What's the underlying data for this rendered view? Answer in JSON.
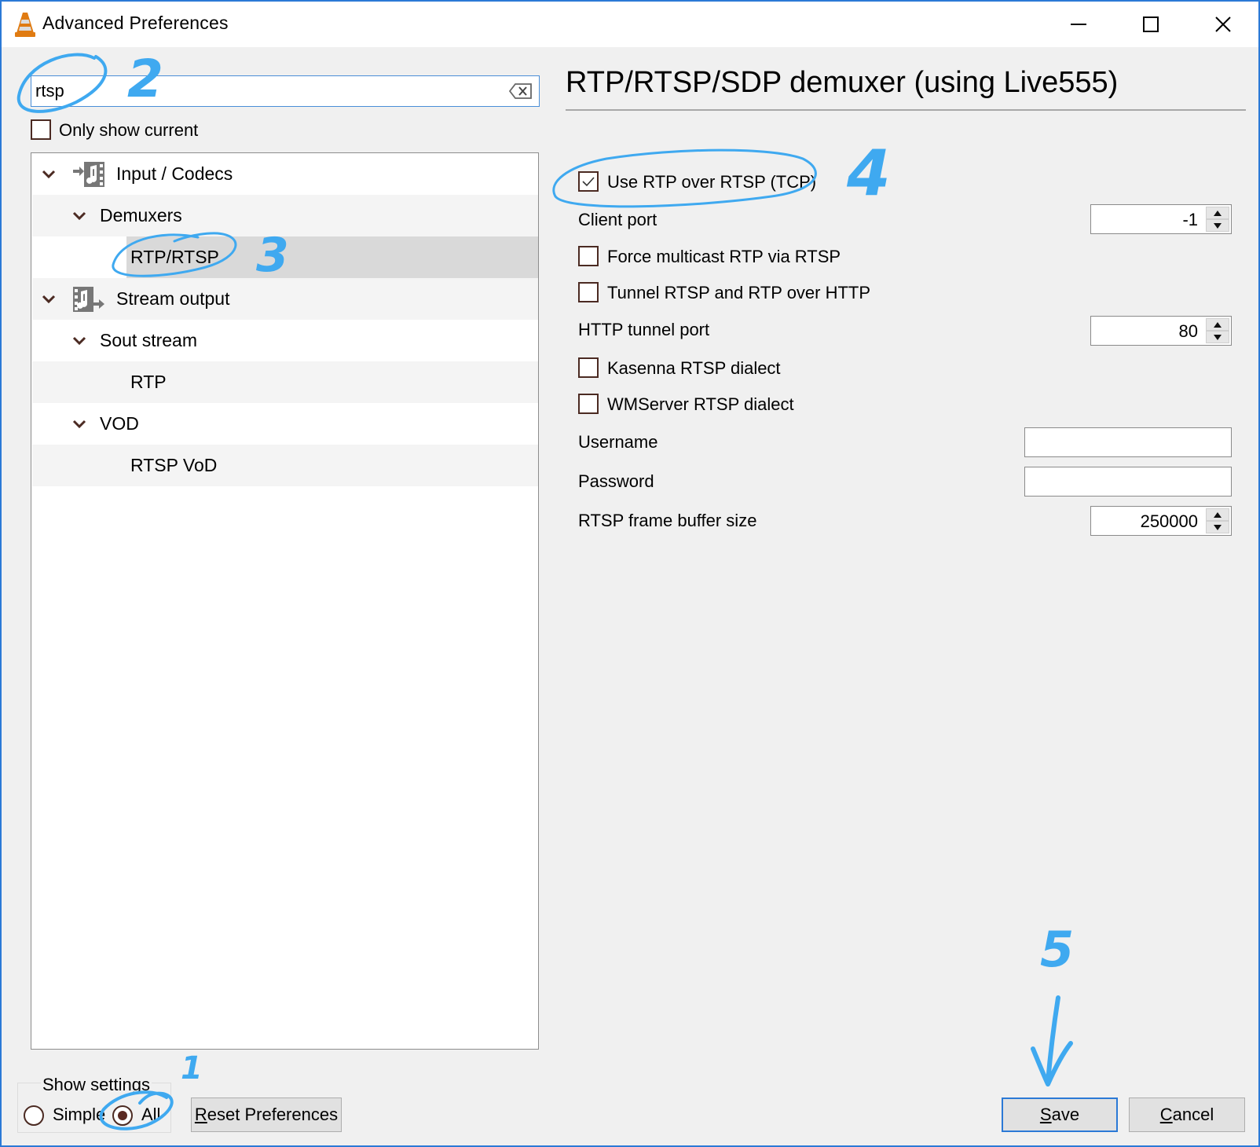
{
  "window": {
    "title": "Advanced Preferences",
    "controls": {
      "minimize": "minimize",
      "maximize": "maximize",
      "close": "close"
    }
  },
  "left": {
    "search": {
      "value": "rtsp",
      "clear_icon": "clear-backspace-icon"
    },
    "only_show_current": {
      "label": "Only show current",
      "checked": false
    },
    "tree": [
      {
        "label": "Input / Codecs",
        "level": 0,
        "expanded": true,
        "icon": "input-codecs-icon",
        "selected": false
      },
      {
        "label": "Demuxers",
        "level": 1,
        "expanded": true,
        "selected": false
      },
      {
        "label": "RTP/RTSP",
        "level": 2,
        "selected": true
      },
      {
        "label": "Stream output",
        "level": 0,
        "expanded": true,
        "icon": "stream-output-icon",
        "selected": false
      },
      {
        "label": "Sout stream",
        "level": 1,
        "expanded": true,
        "selected": false
      },
      {
        "label": "RTP",
        "level": 2,
        "selected": false
      },
      {
        "label": "VOD",
        "level": 1,
        "expanded": true,
        "selected": false
      },
      {
        "label": "RTSP VoD",
        "level": 2,
        "selected": false
      }
    ]
  },
  "right": {
    "section_title": "RTP/RTSP/SDP demuxer (using Live555)",
    "options": {
      "use_rtp_over_rtsp": {
        "label": "Use RTP over RTSP (TCP)",
        "checked": true
      },
      "client_port": {
        "label": "Client port",
        "value": "-1"
      },
      "force_multicast": {
        "label": "Force multicast RTP via RTSP",
        "checked": false
      },
      "tunnel_http": {
        "label": "Tunnel RTSP and RTP over HTTP",
        "checked": false
      },
      "http_tunnel_port": {
        "label": "HTTP tunnel port",
        "value": "80"
      },
      "kasenna": {
        "label": "Kasenna RTSP dialect",
        "checked": false
      },
      "wmserver": {
        "label": "WMServer RTSP dialect",
        "checked": false
      },
      "username": {
        "label": "Username",
        "value": ""
      },
      "password": {
        "label": "Password",
        "value": ""
      },
      "frame_buffer": {
        "label": "RTSP frame buffer size",
        "value": "250000"
      }
    }
  },
  "bottom": {
    "show_settings": {
      "title": "Show settings",
      "options": [
        {
          "label": "Simple",
          "selected": false
        },
        {
          "label": "All",
          "selected": true
        }
      ]
    },
    "reset_button": {
      "mnemonic": "R",
      "rest": "eset Preferences"
    },
    "save_button": {
      "mnemonic": "S",
      "rest": "ave"
    },
    "cancel_button": {
      "mnemonic": "C",
      "rest": "ancel"
    }
  },
  "annotations": {
    "color": "#3fa9f0",
    "steps": [
      "1",
      "2",
      "3",
      "4",
      "5"
    ]
  }
}
